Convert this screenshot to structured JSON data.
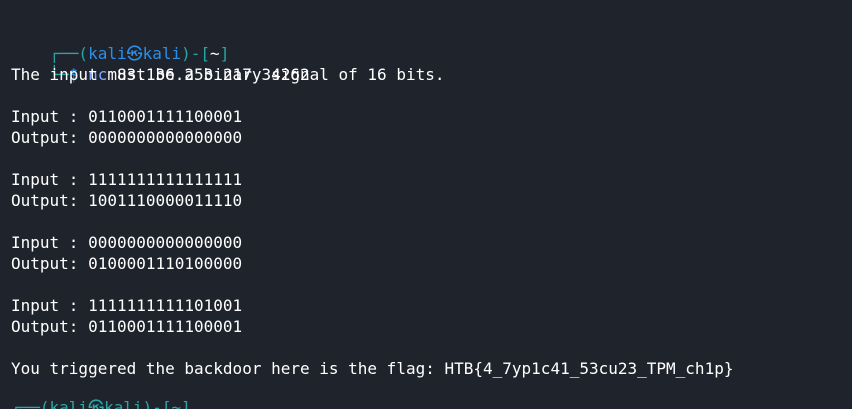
{
  "prompt": {
    "box_top_left": "┌──(",
    "user": "kali",
    "at": "㉿",
    "host": "kali",
    "close_paren": ")-[",
    "cwd": "~",
    "close_bracket": "]",
    "box_bottom_left": "└─",
    "dollar": "$",
    "command_name": "nc",
    "command_args": "83.136.253.217 34262"
  },
  "output": {
    "intro": "The input must be a binary signal of 16 bits.",
    "pairs": [
      {
        "input_label": "Input : ",
        "input_value": "0110001111100001",
        "output_label": "Output: ",
        "output_value": "0000000000000000"
      },
      {
        "input_label": "Input : ",
        "input_value": "1111111111111111",
        "output_label": "Output: ",
        "output_value": "1001110000011110"
      },
      {
        "input_label": "Input : ",
        "input_value": "0000000000000000",
        "output_label": "Output: ",
        "output_value": "0100001110100000"
      },
      {
        "input_label": "Input : ",
        "input_value": "1111111111101001",
        "output_label": "Output: ",
        "output_value": "0110001111100001"
      }
    ],
    "flag_message": "You triggered the backdoor here is the flag: HTB{4_7yp1c41_53cu23_TPM_ch1p}"
  },
  "next_prompt_fragment": "┌──(kali㉿kali)-[~]"
}
